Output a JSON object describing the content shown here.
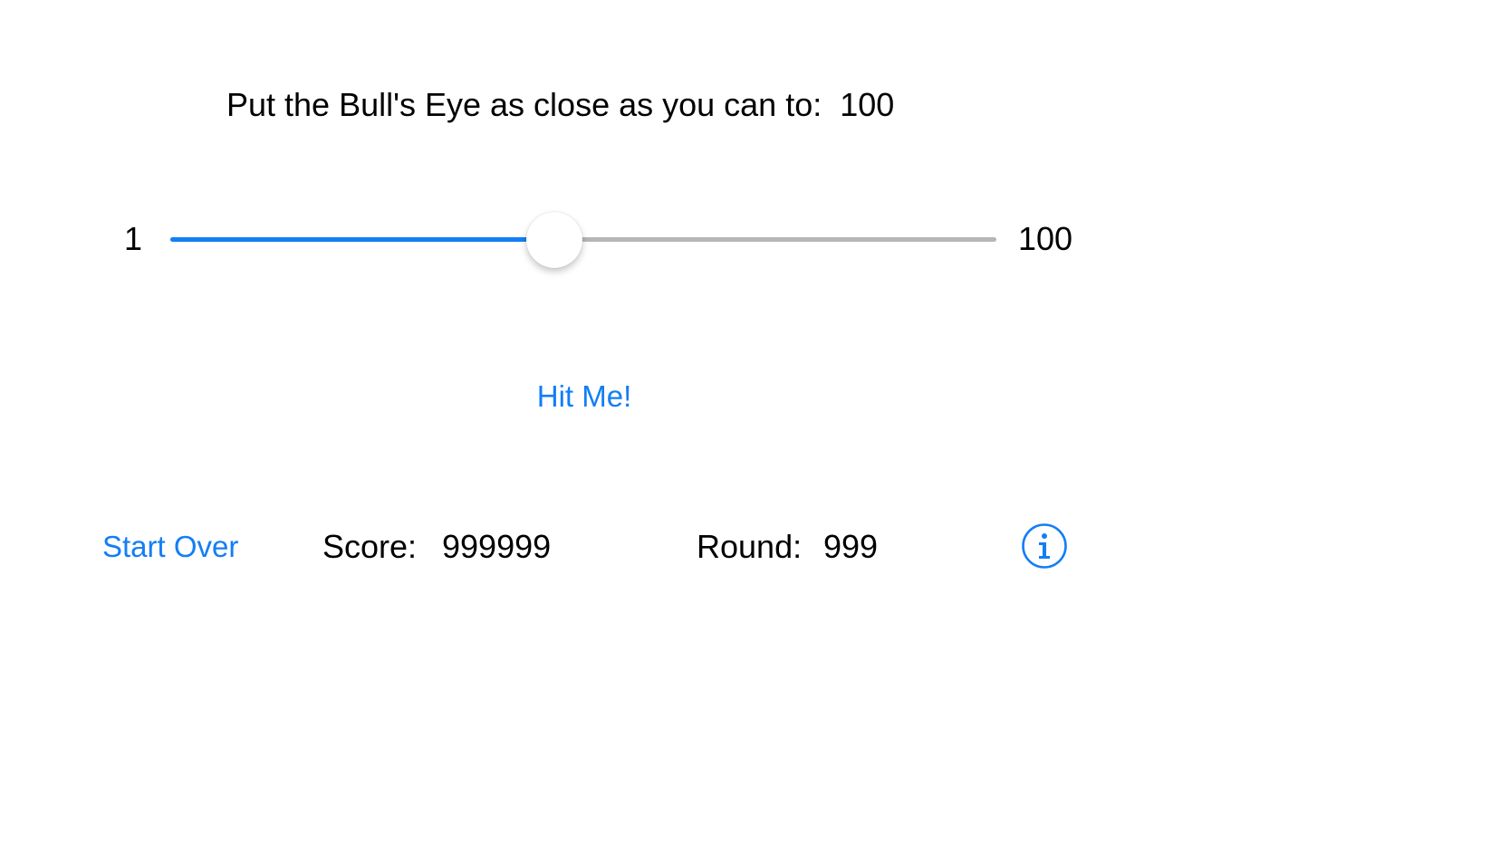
{
  "header": {
    "prompt_label": "Put the Bull's Eye as close as you can to:",
    "target_value": "100"
  },
  "slider": {
    "min_label": "1",
    "max_label": "100",
    "min": 1,
    "max": 100,
    "value": 47
  },
  "actions": {
    "hit_label": "Hit Me!",
    "start_over_label": "Start Over",
    "info_icon": "info-circle-icon"
  },
  "stats": {
    "score_label": "Score:",
    "score_value": "999999",
    "round_label": "Round:",
    "round_value": "999"
  },
  "colors": {
    "accent": "#137ef5",
    "track": "#b6b6b6",
    "text": "#000000",
    "background": "#ffffff"
  }
}
